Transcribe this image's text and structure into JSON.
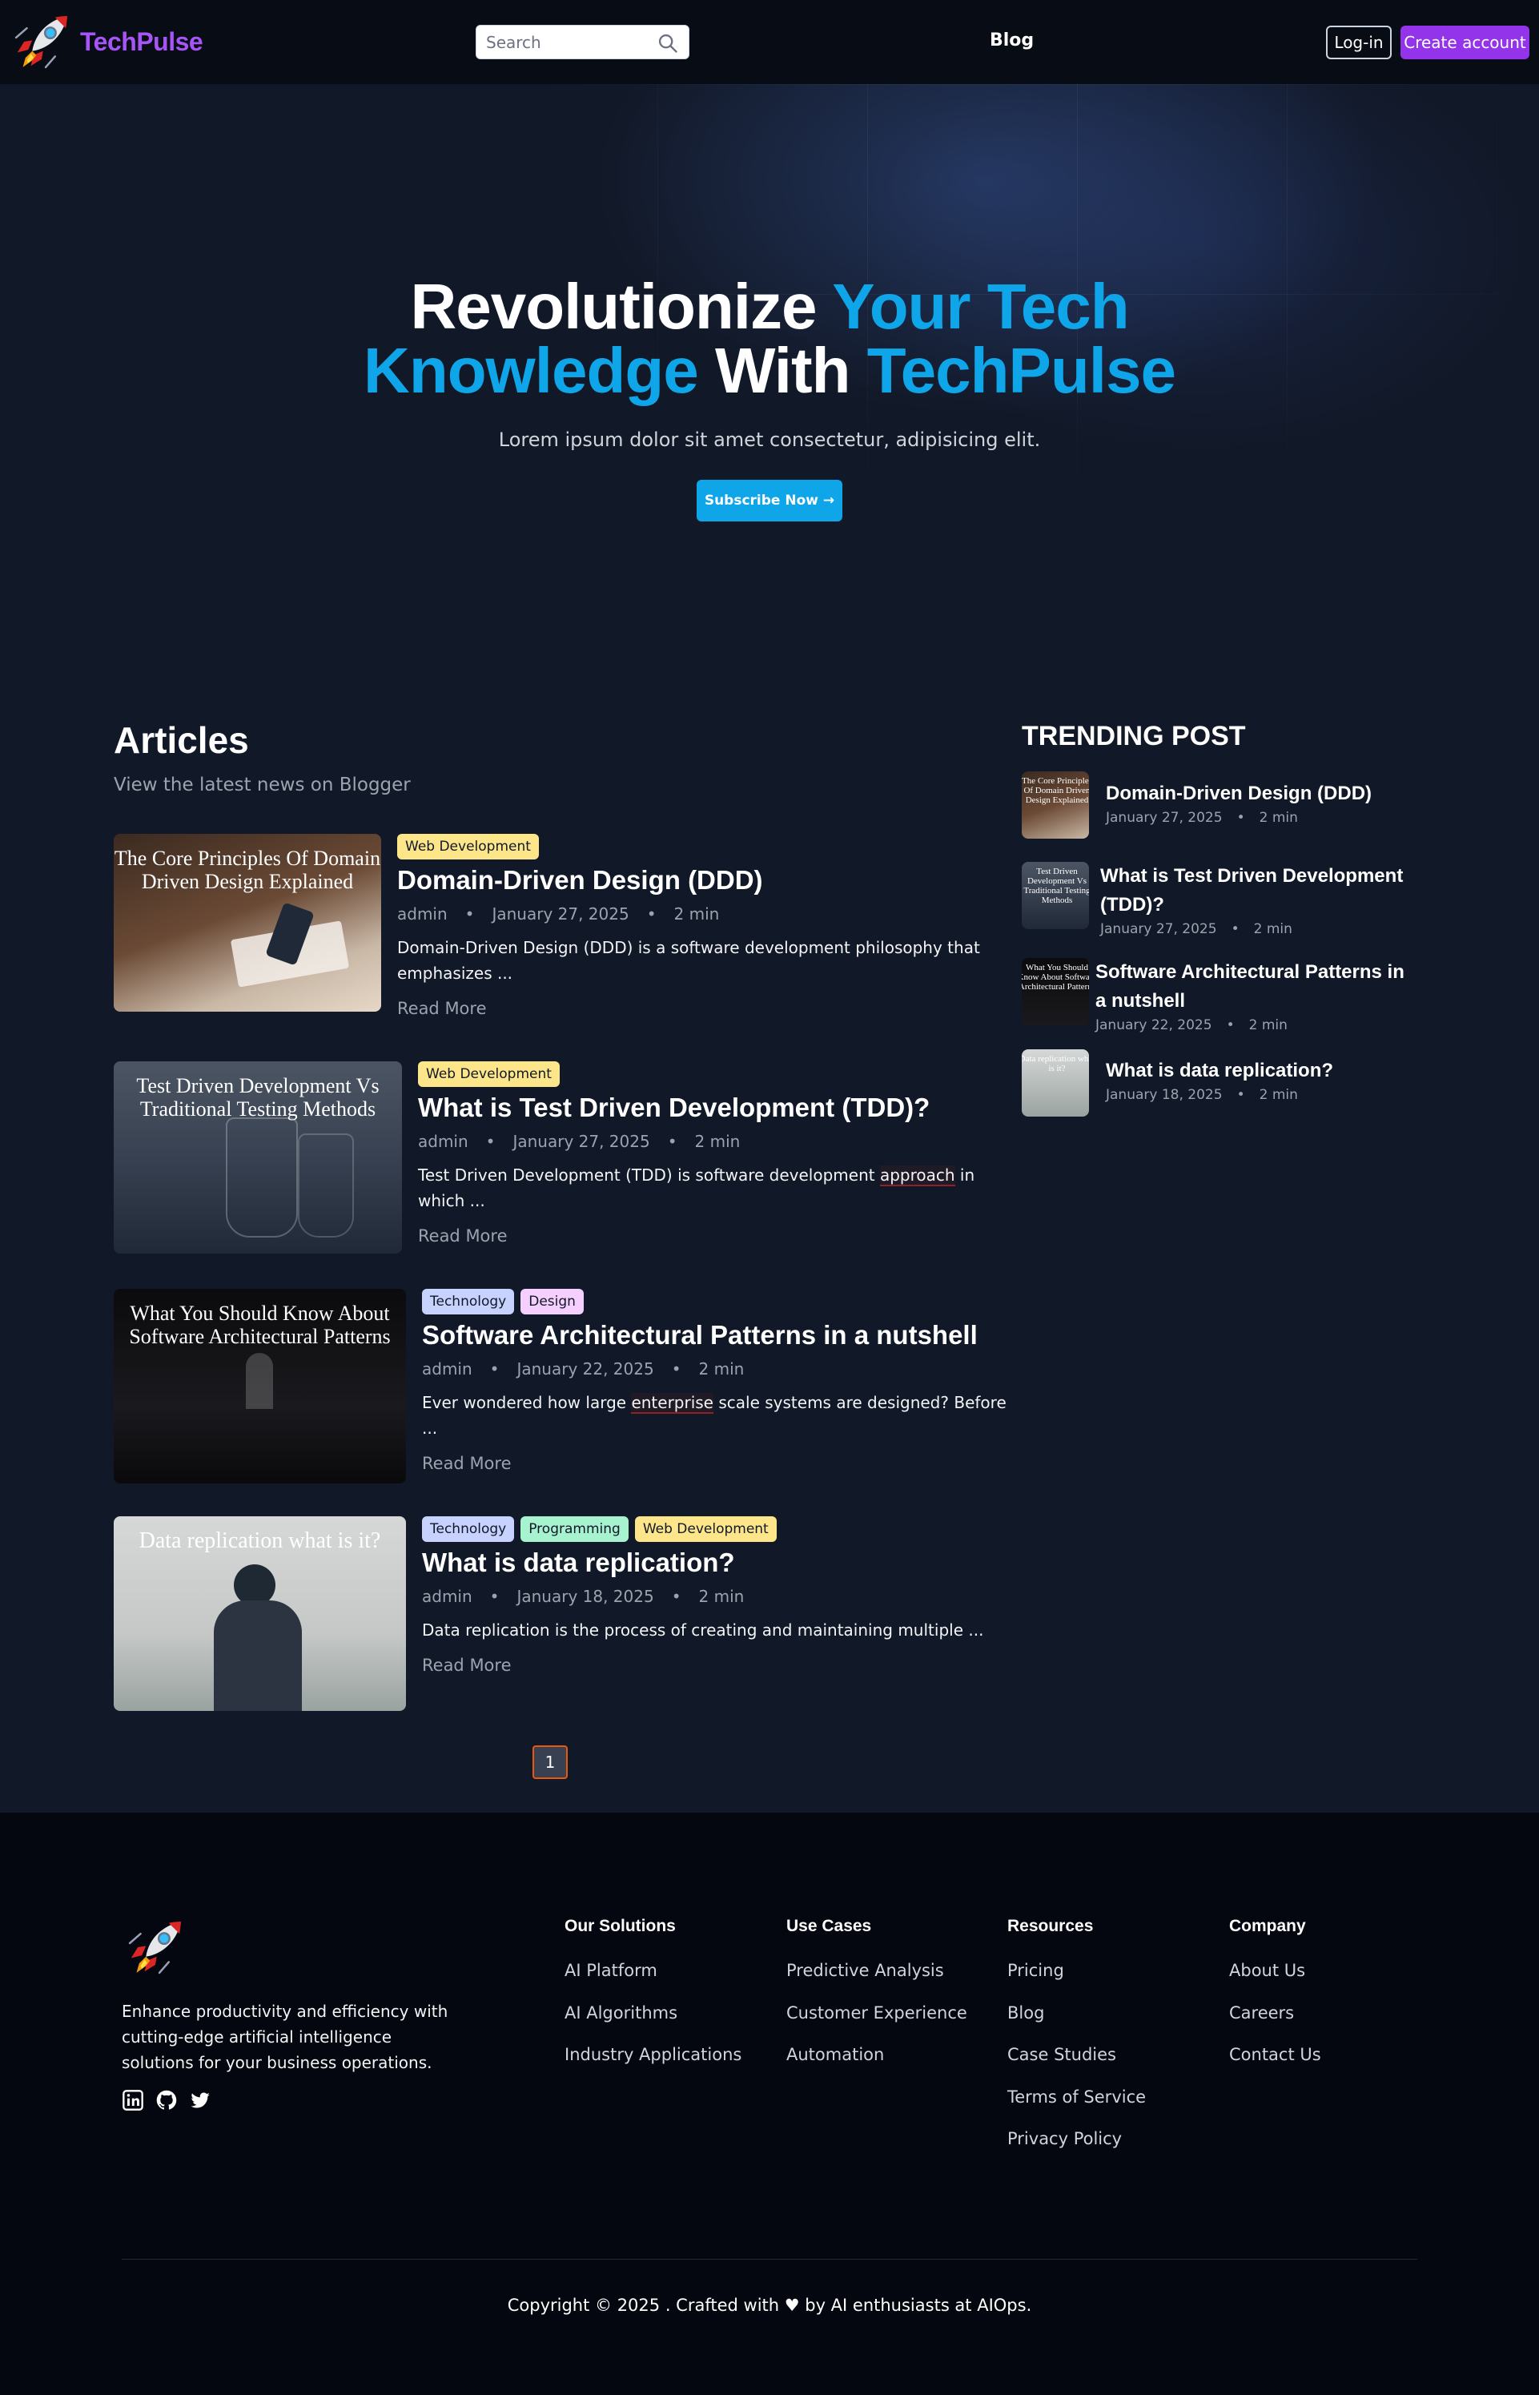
{
  "header": {
    "brand": "TechPulse",
    "search_placeholder": "Search",
    "nav_blog": "Blog",
    "login": "Log-in",
    "create_account": "Create account"
  },
  "hero": {
    "title_part1": "Revolutionize ",
    "title_accent1": "Your Tech",
    "title_accent2": "Knowledge",
    "title_part2": " With ",
    "title_accent3": "TechPulse",
    "subtitle": "Lorem ipsum dolor sit amet consectetur, adipisicing elit.",
    "cta": "Subscribe Now →"
  },
  "articles": {
    "heading": "Articles",
    "subheading": "View the latest news on Blogger",
    "read_more": "Read More",
    "items": [
      {
        "tags": [
          "Web Development"
        ],
        "title": "Domain-Driven Design (DDD)",
        "author": "admin",
        "date": "January 27, 2025",
        "read_time": "2 min",
        "excerpt": "Domain-Driven Design (DDD) is a software development philosophy that emphasizes ...",
        "thumb_caption": "The Core Principles Of Domain Driven Design Explained"
      },
      {
        "tags": [
          "Web Development"
        ],
        "title": "What is Test Driven Development (TDD)?",
        "author": "admin",
        "date": "January 27, 2025",
        "read_time": "2 min",
        "excerpt_pre": "Test Driven Development (TDD) is software development ",
        "excerpt_hl": "approach",
        "excerpt_post": " in which ...",
        "thumb_caption": "Test Driven Development Vs Traditional Testing Methods"
      },
      {
        "tags": [
          "Technology",
          "Design"
        ],
        "title": "Software Architectural Patterns in a nutshell",
        "author": "admin",
        "date": "January 22, 2025",
        "read_time": "2 min",
        "excerpt_pre": "Ever wondered how large ",
        "excerpt_hl": "enterprise",
        "excerpt_post": " scale systems are designed? Before ...",
        "thumb_caption": "What You Should Know About Software Architectural Patterns"
      },
      {
        "tags": [
          "Technology",
          "Programming",
          "Web Development"
        ],
        "title": "What is data replication?",
        "author": "admin",
        "date": "January 18, 2025",
        "read_time": "2 min",
        "excerpt": "Data replication is the process of creating and maintaining multiple ...",
        "thumb_caption": "Data replication what is it?"
      }
    ]
  },
  "pagination": {
    "current": "1"
  },
  "trending": {
    "heading": "TRENDING POST",
    "items": [
      {
        "title": "Domain-Driven Design (DDD)",
        "date": "January 27, 2025",
        "read_time": "2 min",
        "thumb_caption": "The Core Principles Of Domain Driven Design Explained"
      },
      {
        "title": "What is Test Driven Development (TDD)?",
        "date": "January 27, 2025",
        "read_time": "2 min",
        "thumb_caption": "Test Driven Development Vs Traditional Testing Methods"
      },
      {
        "title": "Software Architectural Patterns in a nutshell",
        "date": "January 22, 2025",
        "read_time": "2 min",
        "thumb_caption": "What You Should Know About Software Architectural Patterns"
      },
      {
        "title": "What is data replication?",
        "date": "January 18, 2025",
        "read_time": "2 min",
        "thumb_caption": "Data replication what is it?"
      }
    ]
  },
  "footer": {
    "description": "Enhance productivity and efficiency with cutting-edge artificial intelligence solutions for your business operations.",
    "social_icons": [
      "linkedin-icon",
      "github-icon",
      "twitter-icon"
    ],
    "columns": [
      {
        "title": "Our Solutions",
        "links": [
          "AI Platform",
          "AI Algorithms",
          "Industry Applications"
        ]
      },
      {
        "title": "Use Cases",
        "links": [
          "Predictive Analysis",
          "Customer Experience",
          "Automation"
        ]
      },
      {
        "title": "Resources",
        "links": [
          "Pricing",
          "Blog",
          "Case Studies",
          "Terms of Service",
          "Privacy Policy"
        ]
      },
      {
        "title": "Company",
        "links": [
          "About Us",
          "Careers",
          "Contact Us"
        ]
      }
    ],
    "copyright": "Copyright © 2025 . Crafted with ♥ by AI enthusiasts at AIOps."
  },
  "colors": {
    "brand_purple": "#a855f7",
    "accent_blue": "#0ea5e9",
    "create_button": "#9333ea",
    "page_bg": "#111827",
    "nav_bg": "#080c14",
    "footer_bg": "#04070f"
  }
}
